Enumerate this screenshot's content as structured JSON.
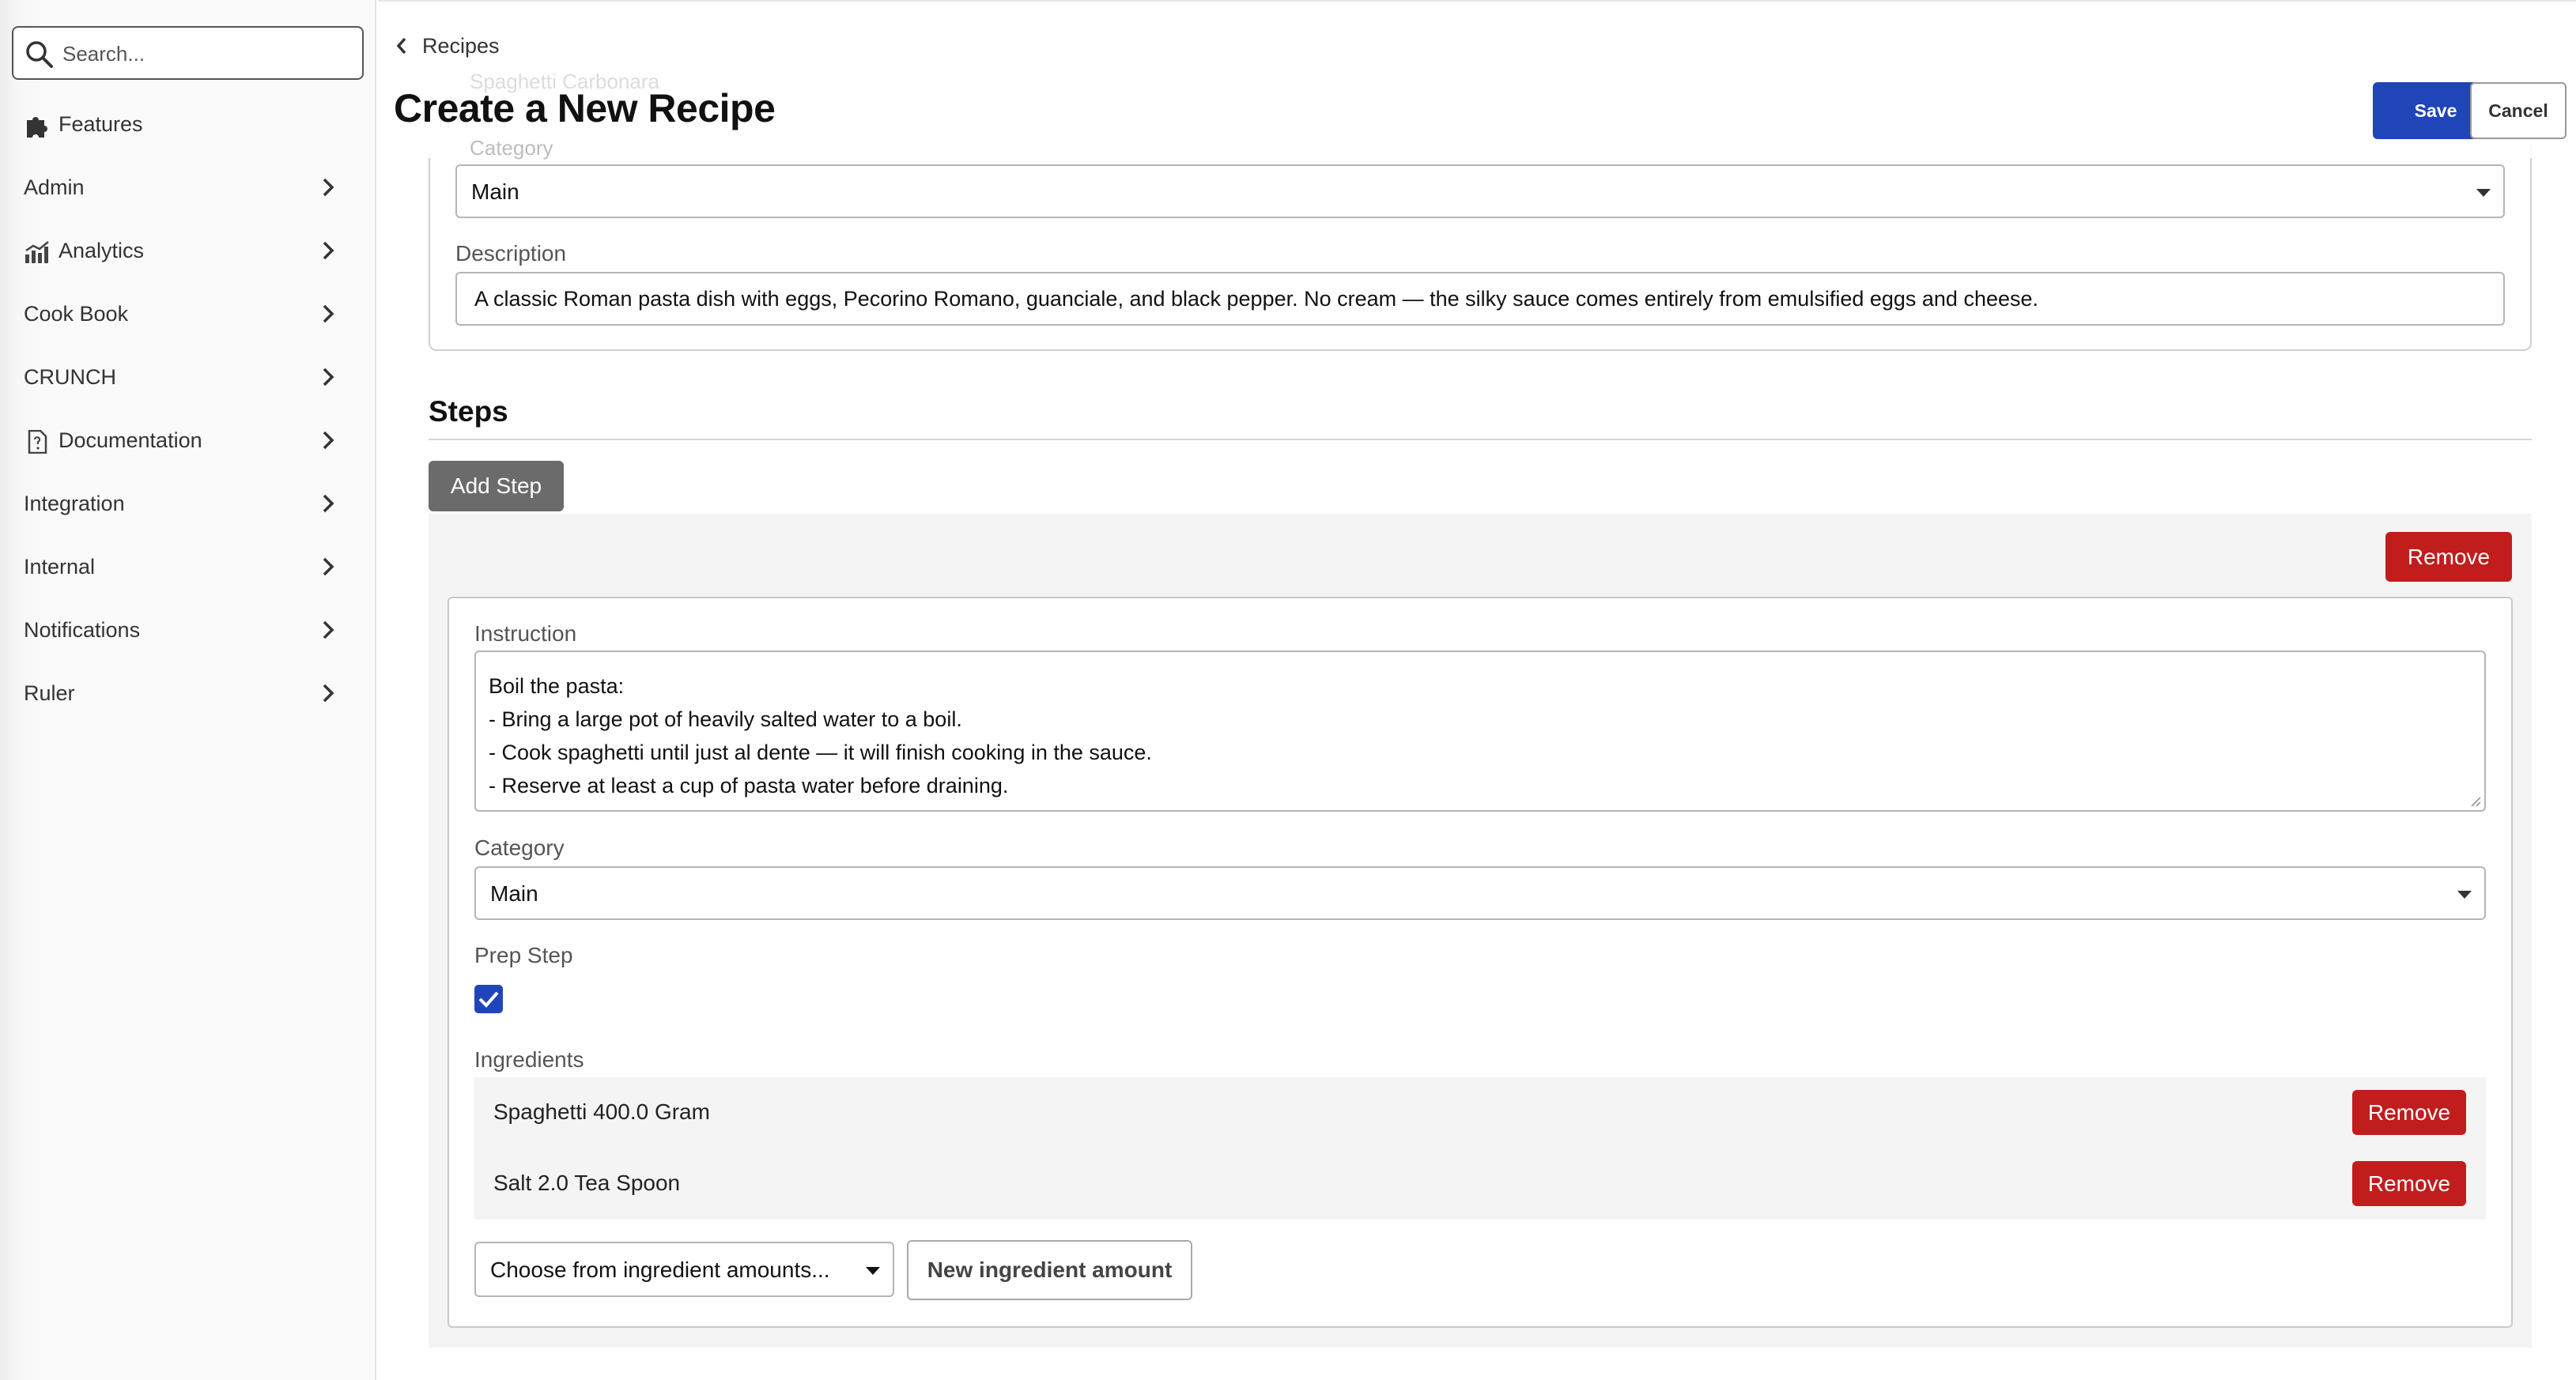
{
  "search": {
    "placeholder": "Search..."
  },
  "sidebar": {
    "items": [
      {
        "label": "Features",
        "icon": "puzzle-icon",
        "has_chevron": false
      },
      {
        "label": "Admin",
        "icon": null,
        "has_chevron": true
      },
      {
        "label": "Analytics",
        "icon": "analytics-chart-icon",
        "has_chevron": true
      },
      {
        "label": "Cook Book",
        "icon": null,
        "has_chevron": true
      },
      {
        "label": "CRUNCH",
        "icon": null,
        "has_chevron": true
      },
      {
        "label": "Documentation",
        "icon": "document-icon",
        "has_chevron": true
      },
      {
        "label": "Integration",
        "icon": null,
        "has_chevron": true
      },
      {
        "label": "Internal",
        "icon": null,
        "has_chevron": true
      },
      {
        "label": "Notifications",
        "icon": null,
        "has_chevron": true
      },
      {
        "label": "Ruler",
        "icon": null,
        "has_chevron": true
      }
    ]
  },
  "header": {
    "back_label": "Recipes",
    "ghost_name": "Spaghetti Carbonara",
    "ghost_category_label": "Category",
    "title": "Create a New Recipe",
    "save_label": "Save",
    "cancel_label": "Cancel"
  },
  "recipe": {
    "category_value": "Main",
    "description_label": "Description",
    "description_value": "A classic Roman pasta dish with eggs, Pecorino Romano, guanciale, and black pepper. No cream — the silky sauce comes entirely from emulsified eggs and cheese."
  },
  "steps": {
    "title": "Steps",
    "add_step_label": "Add Step",
    "items": [
      {
        "remove_label": "Remove",
        "instruction_label": "Instruction",
        "instruction_lines": [
          "Boil the pasta:",
          "- Bring a large pot of heavily salted water to a boil.",
          "- Cook spaghetti until just al dente — it will finish cooking in the sauce.",
          "- Reserve at least a cup of pasta water before draining."
        ],
        "category_label": "Category",
        "category_value": "Main",
        "prep_step_label": "Prep Step",
        "prep_step_checked": true,
        "ingredients_label": "Ingredients",
        "ingredients": [
          {
            "text": "Spaghetti 400.0 Gram",
            "remove_label": "Remove"
          },
          {
            "text": "Salt 2.0 Tea Spoon",
            "remove_label": "Remove"
          }
        ],
        "choose_placeholder": "Choose from ingredient amounts...",
        "new_ingredient_label": "New ingredient amount"
      }
    ]
  },
  "colors": {
    "primary": "#1f45b8",
    "danger": "#c11d1d",
    "secondary": "#6b6b6b"
  }
}
